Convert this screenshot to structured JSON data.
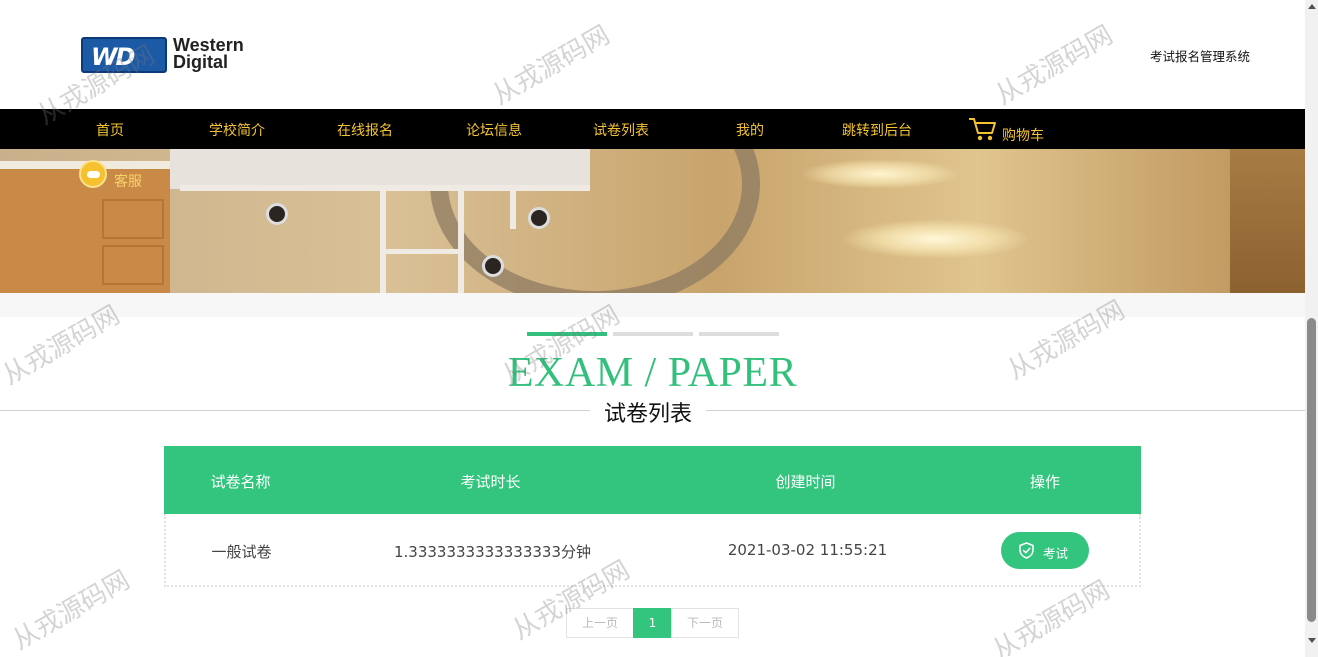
{
  "header": {
    "logo_badge": "WD",
    "logo_line1": "Western",
    "logo_line2": "Digital",
    "site_title": "考试报名管理系统"
  },
  "nav": {
    "items": [
      "首页",
      "学校简介",
      "在线报名",
      "论坛信息",
      "试卷列表",
      "我的",
      "跳转到后台"
    ],
    "cart_label": "购物车",
    "cart_icon": "shopping-cart-icon"
  },
  "banner": {
    "service_label": "客服",
    "service_icon": "customer-service-icon"
  },
  "section": {
    "en_title": "EXAM / PAPER",
    "cn_title": "试卷列表"
  },
  "table": {
    "headers": [
      "试卷名称",
      "考试时长",
      "创建时间",
      "操作"
    ],
    "rows": [
      {
        "name": "一般试卷",
        "duration": "1.3333333333333333分钟",
        "created": "2021-03-02 11:55:21",
        "action_label": "考试",
        "action_icon": "shield-check-icon"
      }
    ]
  },
  "pagination": {
    "prev": "上一页",
    "current": "1",
    "next": "下一页"
  },
  "watermark": "从戎源码网",
  "colors": {
    "accent": "#33c47e",
    "nav_bg": "#000000",
    "nav_text": "#f4c430"
  }
}
